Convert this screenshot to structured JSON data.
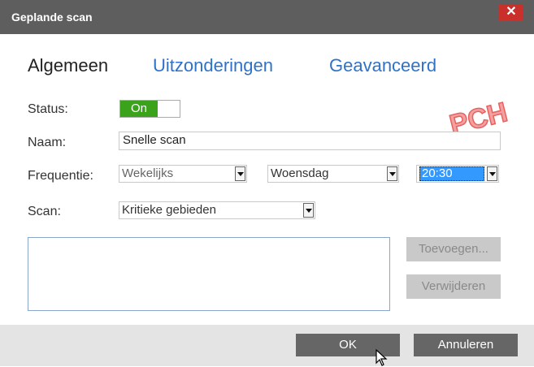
{
  "window": {
    "title": "Geplande scan",
    "close_glyph": "✕"
  },
  "tabs": [
    {
      "label": "Algemeen",
      "active": true
    },
    {
      "label": "Uitzonderingen",
      "active": false
    },
    {
      "label": "Geavanceerd",
      "active": false
    }
  ],
  "watermark": "PCH",
  "form": {
    "status_label": "Status:",
    "status_toggle": "On",
    "naam_label": "Naam:",
    "naam_value": "Snelle scan",
    "frequentie_label": "Frequentie:",
    "frequency": "Wekelijks",
    "day": "Woensdag",
    "time": "20:30",
    "scan_label": "Scan:",
    "scan_value": "Kritieke gebieden"
  },
  "side_buttons": {
    "add": "Toevoegen...",
    "remove": "Verwijderen"
  },
  "footer": {
    "ok": "OK",
    "cancel": "Annuleren"
  },
  "colors": {
    "titlebar": "#5e5e5e",
    "close": "#c9302c",
    "toggle_on": "#3aa21b",
    "tab_link": "#2f72c8",
    "watermark": "#e8615f"
  }
}
